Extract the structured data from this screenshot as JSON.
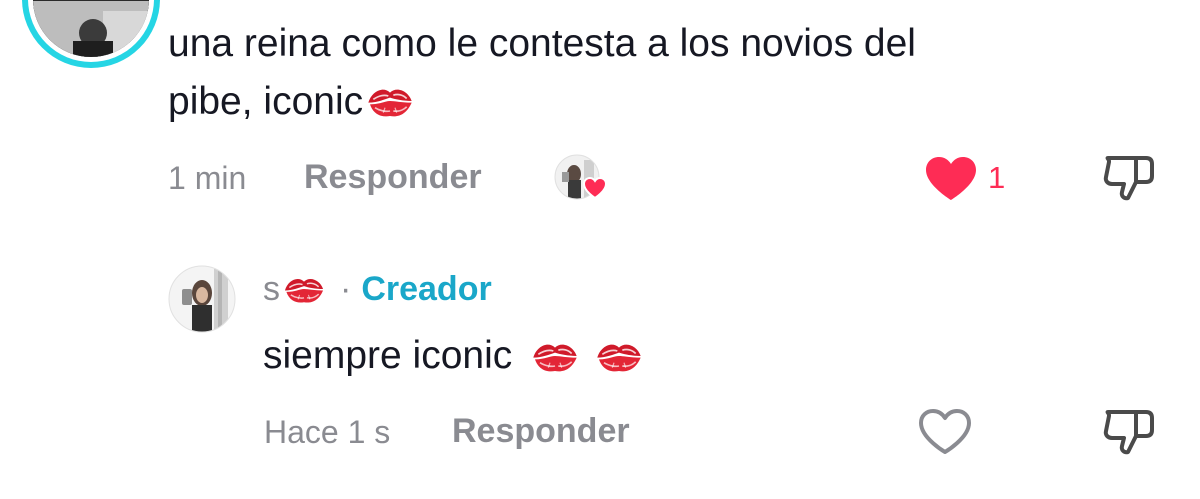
{
  "comment1": {
    "text_line1": "una reina como le contesta a los novios del",
    "text_line2": "pibe, iconic",
    "time": "1 min",
    "reply_label": "Responder",
    "like_count": "1",
    "liked": true
  },
  "comment2": {
    "username": "s",
    "separator": "·",
    "badge": "Creador",
    "text": "siempre iconic",
    "time": "Hace 1 s",
    "reply_label": "Responder",
    "liked": false
  },
  "icons": {
    "kiss": "kiss-mark-icon",
    "heart_filled": "heart-filled-icon",
    "heart_outline": "heart-outline-icon",
    "dislike": "thumbs-down-icon"
  },
  "colors": {
    "accent_red": "#fe2c55",
    "creator_blue": "#1aa7c9",
    "story_ring": "#25d5e4",
    "meta_gray": "#8a8b91",
    "text": "#161823"
  }
}
